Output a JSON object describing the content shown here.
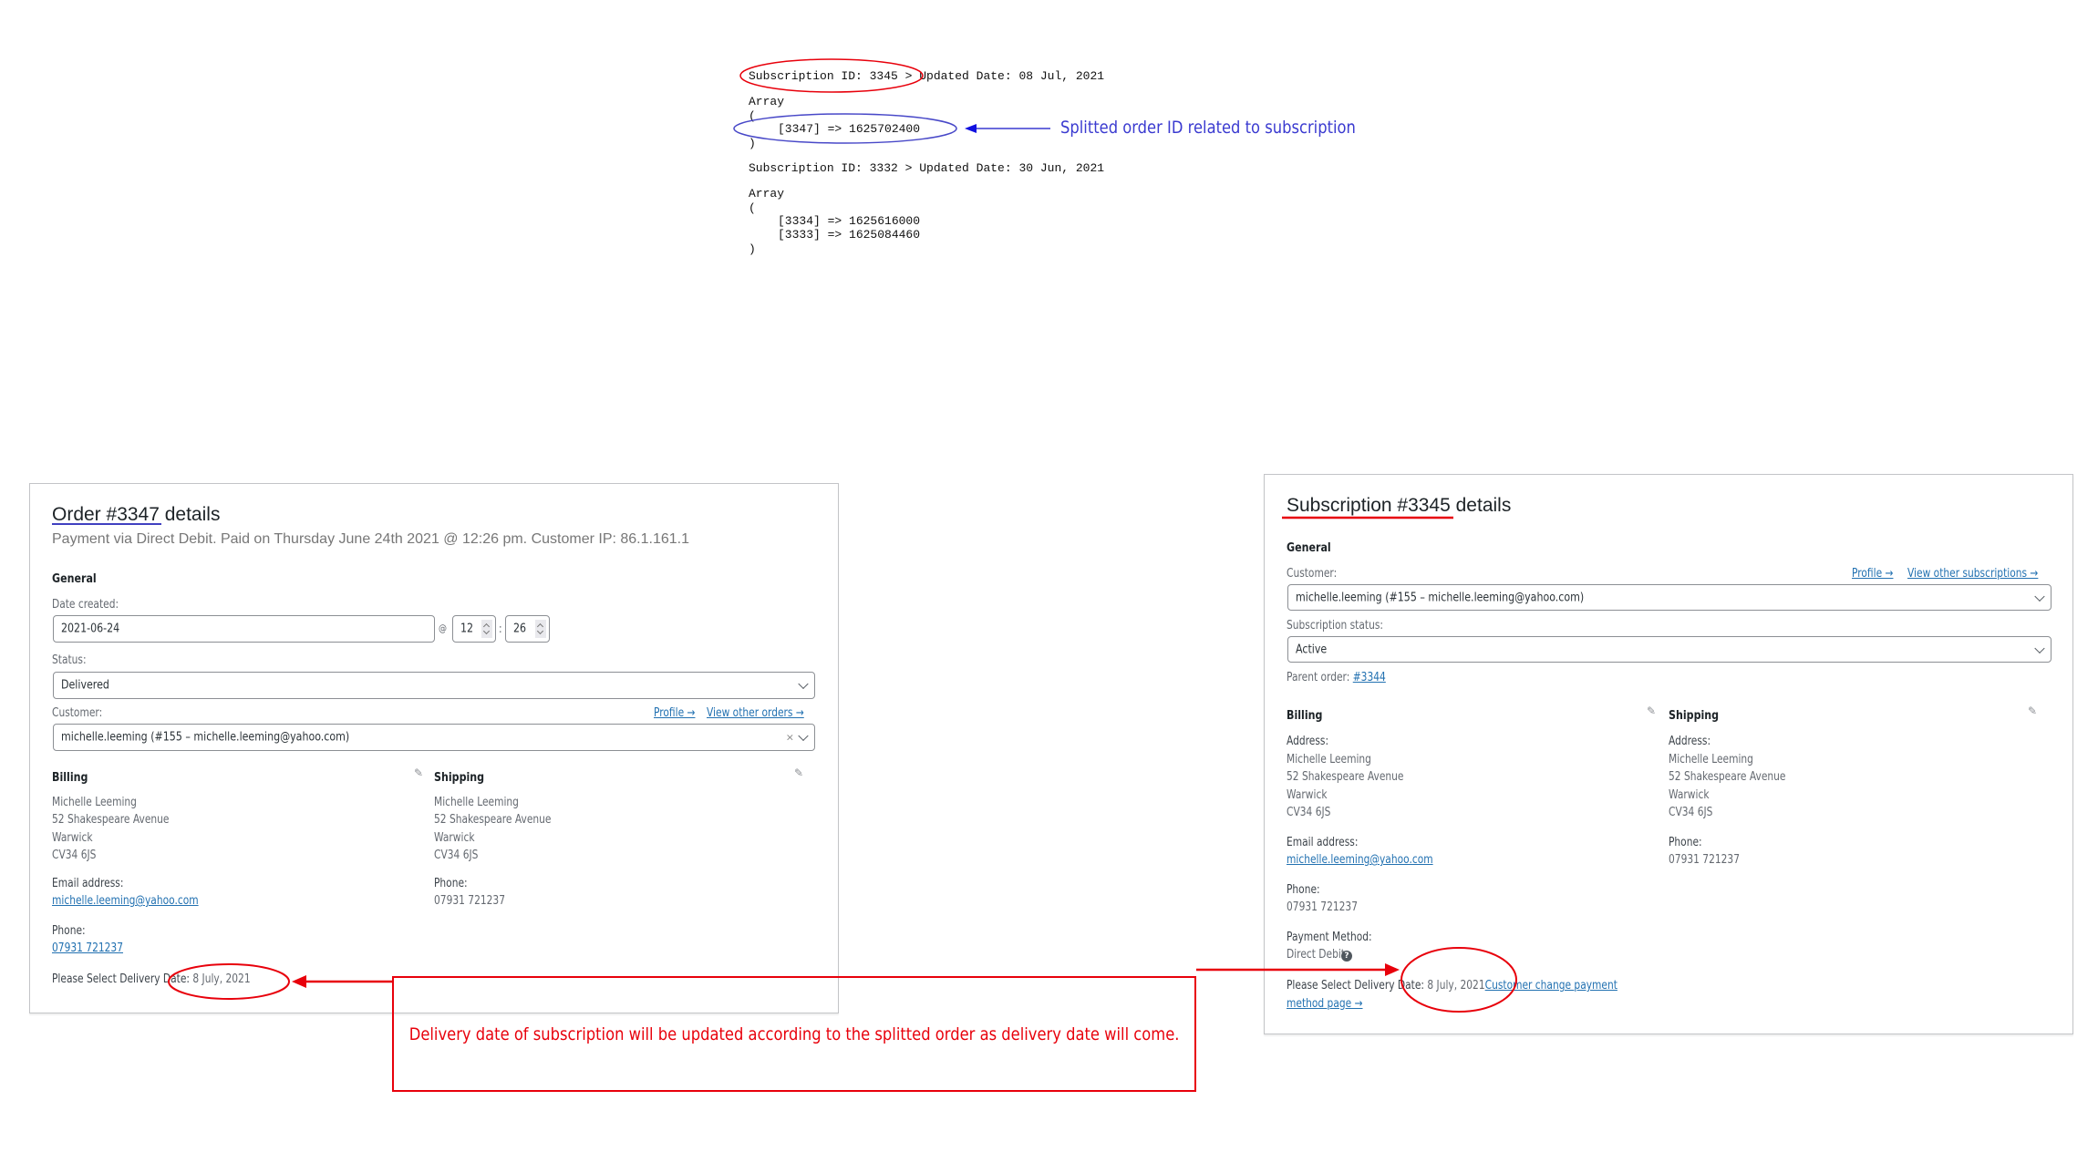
{
  "debug_output": {
    "blocks": [
      {
        "header": "Subscription ID: 3345 > Updated Date: 08 Jul, 2021",
        "array_label": "Array",
        "open": "(",
        "entries": [
          "[3347] => 1625702400"
        ],
        "close": ")"
      },
      {
        "header": "Subscription ID: 3332 > Updated Date: 30 Jun, 2021",
        "array_label": "Array",
        "open": "(",
        "entries": [
          "[3334] => 1625616000",
          "[3333] => 1625084460"
        ],
        "close": ")"
      }
    ],
    "blue_annotation": "Splitted order ID related to subscription"
  },
  "order_panel": {
    "title": "Order #3347 details",
    "subtitle": "Payment via Direct Debit. Paid on Thursday June 24th 2021 @ 12:26 pm. Customer IP: 86.1.161.1",
    "general_heading": "General",
    "date_created_label": "Date created:",
    "date_value": "2021-06-24",
    "at_symbol": "@",
    "hour_value": "12",
    "colon": ":",
    "minute_value": "26",
    "status_label": "Status:",
    "status_value": "Delivered",
    "customer_label": "Customer:",
    "profile_link": "Profile →",
    "view_other_link": "View other orders →",
    "customer_value": "michelle.leeming (#155 – michelle.leeming@yahoo.com)",
    "clear_glyph": "×",
    "billing": {
      "heading": "Billing",
      "address_lines": [
        "Michelle Leeming",
        "52 Shakespeare Avenue",
        "Warwick",
        "CV34 6JS"
      ],
      "email_label": "Email address:",
      "email": "michelle.leeming@yahoo.com",
      "phone_label": "Phone:",
      "phone": "07931 721237"
    },
    "shipping": {
      "heading": "Shipping",
      "address_lines": [
        "Michelle Leeming",
        "52 Shakespeare Avenue",
        "Warwick",
        "CV34 6JS"
      ],
      "phone_label": "Phone:",
      "phone": "07931 721237"
    },
    "delivery_label": "Please Select Delivery",
    "delivery_date_label": "Date:",
    "delivery_date": "8 July, 2021"
  },
  "subscription_panel": {
    "title": "Subscription #3345 details",
    "general_heading": "General",
    "customer_label": "Customer:",
    "profile_link": "Profile →",
    "view_other_link": "View other subscriptions →",
    "customer_value": "michelle.leeming (#155 – michelle.leeming@yahoo.com)",
    "status_label": "Subscription status:",
    "status_value": "Active",
    "parent_order_label": "Parent order:",
    "parent_order_link": "#3344",
    "billing": {
      "heading": "Billing",
      "address_label": "Address:",
      "address_lines": [
        "Michelle Leeming",
        "52 Shakespeare Avenue",
        "Warwick",
        "CV34 6JS"
      ],
      "email_label": "Email address:",
      "email": "michelle.leeming@yahoo.com",
      "phone_label": "Phone:",
      "phone": "07931 721237",
      "payment_label": "Payment Method:",
      "payment_value": "Direct Debit",
      "help_glyph": "?"
    },
    "shipping": {
      "heading": "Shipping",
      "address_label": "Address:",
      "address_lines": [
        "Michelle Leeming",
        "52 Shakespeare Avenue",
        "Warwick",
        "CV34 6JS"
      ],
      "phone_label": "Phone:",
      "phone": "07931 721237"
    },
    "delivery_label": "Please Select Delivery",
    "delivery_date_label": "Date:",
    "delivery_date": "8 July, 2021",
    "change_payment_link_line1": "Customer change payment",
    "change_payment_link_line2": "method page →"
  },
  "red_annotation": "Delivery date of subscription will be updated according to the splitted order as delivery date will come.",
  "colors": {
    "annotation_red": "#e8000b",
    "annotation_blue": "#3a3ad0",
    "link_blue": "#2271b1"
  }
}
